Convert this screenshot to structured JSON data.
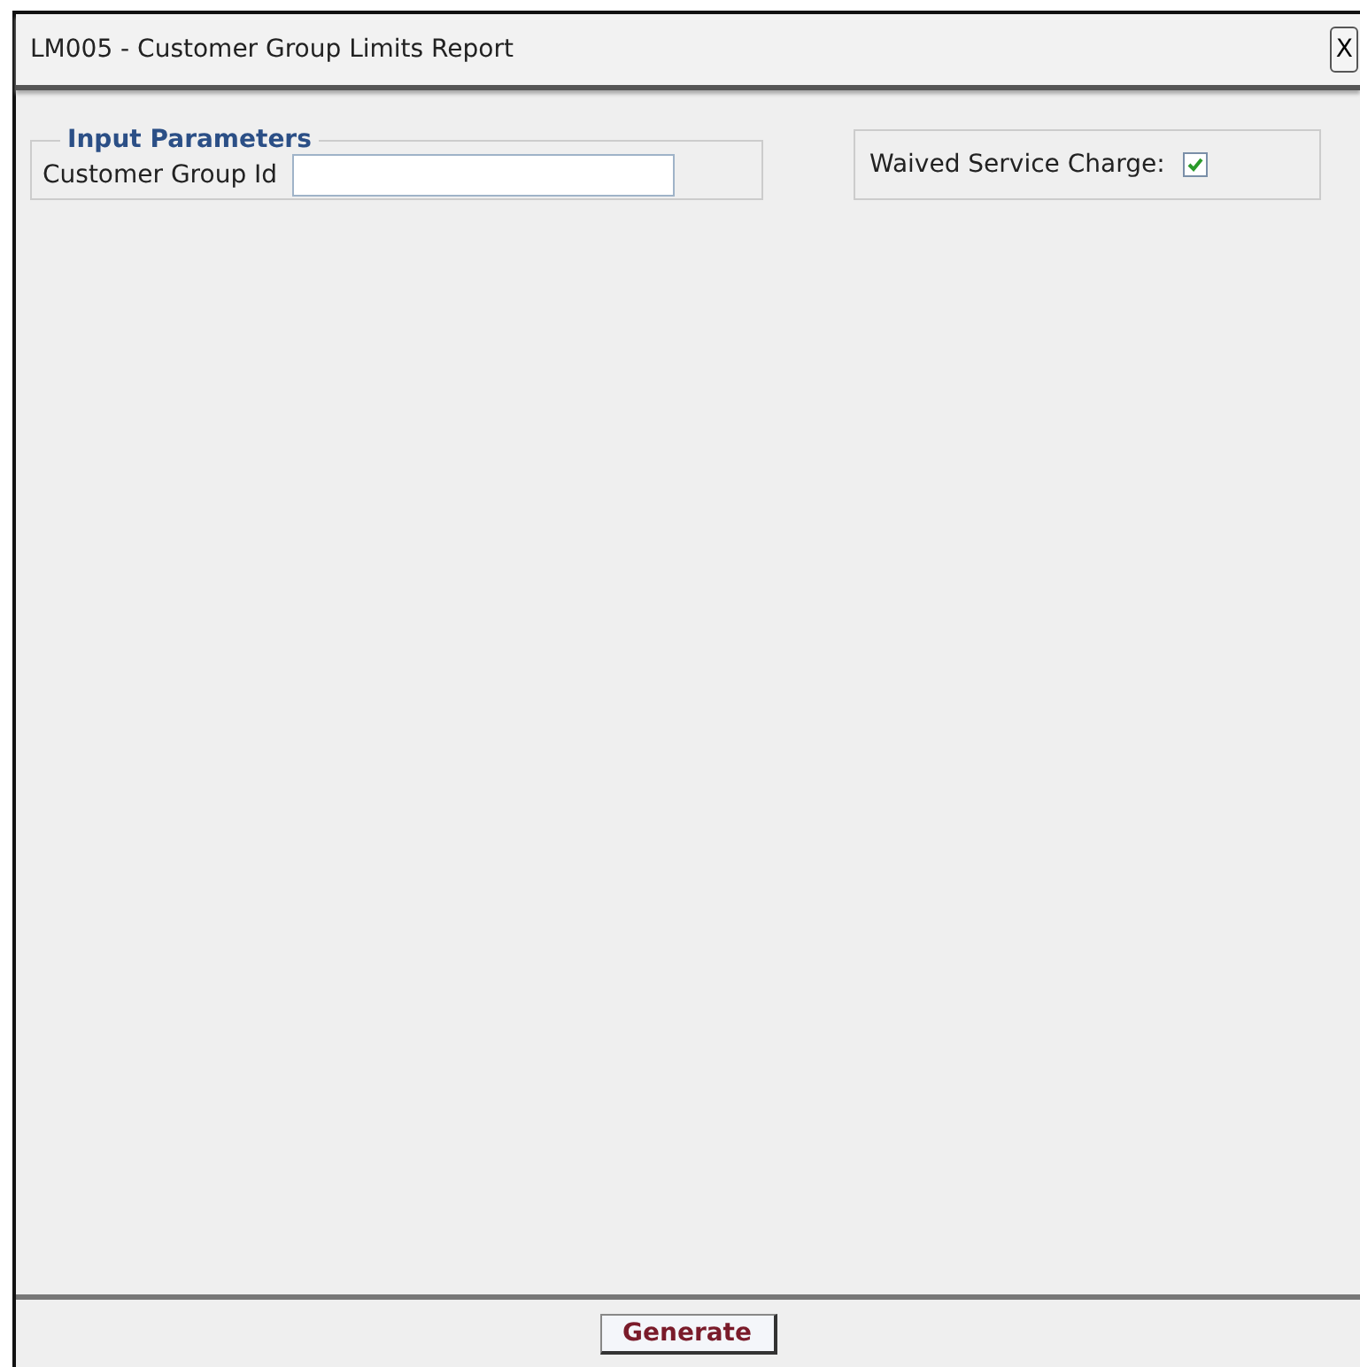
{
  "window": {
    "title": "LM005 - Customer Group Limits Report",
    "close": "X"
  },
  "input_parameters": {
    "legend": "Input Parameters",
    "field_label": "Customer Group Id"
  },
  "waived": {
    "label": "Waived Service Charge:",
    "checked": true
  },
  "buttons": [
    "Generate"
  ]
}
